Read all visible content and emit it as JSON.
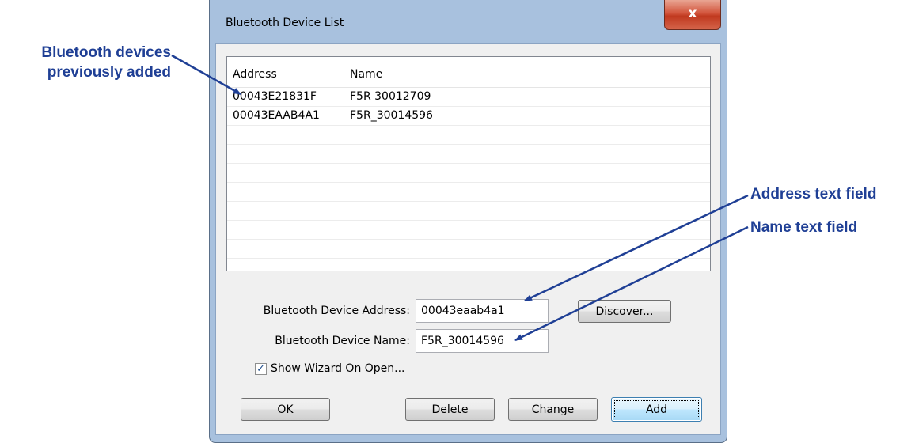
{
  "window": {
    "title": "Bluetooth Device List",
    "close_glyph": "x"
  },
  "device_list": {
    "columns": [
      "Address",
      "Name",
      ""
    ],
    "rows": [
      {
        "address": "00043E21831F",
        "name": "F5R 30012709"
      },
      {
        "address": "00043EAAB4A1",
        "name": "F5R_30014596"
      }
    ]
  },
  "form": {
    "address_label": "Bluetooth Device Address:",
    "address_value": "00043eaab4a1",
    "name_label": "Bluetooth Device Name:",
    "name_value": "F5R_30014596",
    "discover_label": "Discover...",
    "show_wizard_label": "Show Wizard On Open...",
    "show_wizard_checked": true
  },
  "buttons": {
    "ok": "OK",
    "delete": "Delete",
    "change": "Change",
    "add": "Add"
  },
  "callouts": {
    "devices_line1": "Bluetooth devices",
    "devices_line2": "previously added",
    "address_field": "Address text field",
    "name_field": "Name text field"
  },
  "colors": {
    "callout": "#1f3f95",
    "window_frame": "#a8c1de",
    "close_button": "#c0391f"
  }
}
